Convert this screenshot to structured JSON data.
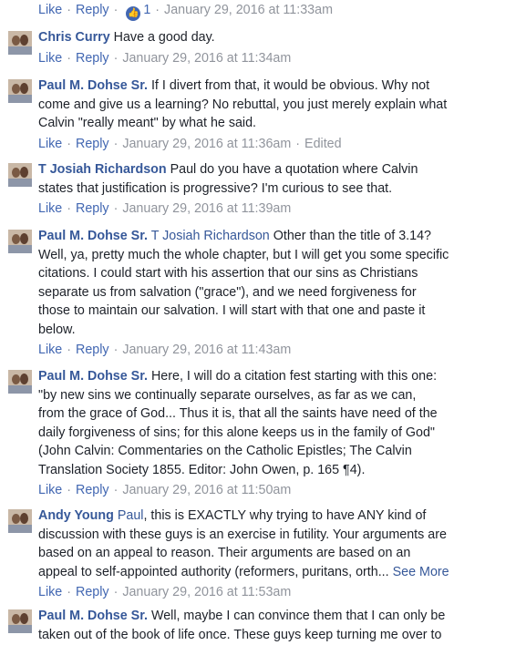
{
  "actions": {
    "like": "Like",
    "reply": "Reply",
    "edited": "Edited",
    "see_more": "See More"
  },
  "top_row": {
    "like_count": "1",
    "timestamp": "January 29, 2016 at 11:33am",
    "like_icon": "thumbs-up-icon",
    "like_icon_color": "#4267b2"
  },
  "comments": [
    {
      "author": "Chris Curry",
      "mention": "",
      "lines": [
        "Have a good day."
      ],
      "timestamp": "January 29, 2016 at 11:34am",
      "edited": false
    },
    {
      "author": "Paul M. Dohse Sr.",
      "mention": "",
      "lines": [
        "If I divert from that, it would be obvious. Why not",
        "come and give us a learning? No rebuttal, you just merely explain what",
        "Calvin \"really meant\" by what he said."
      ],
      "timestamp": "January 29, 2016 at 11:36am",
      "edited": true
    },
    {
      "author": "T Josiah Richardson",
      "mention": "",
      "lines": [
        "Paul do you have a quotation where Calvin",
        "states that justification is progressive? I'm curious to see that."
      ],
      "timestamp": "January 29, 2016 at 11:39am",
      "edited": false
    },
    {
      "author": "Paul M. Dohse Sr.",
      "mention": "T Josiah Richardson",
      "lines": [
        "Other than the title of 3.14?",
        "Well, ya, pretty much the whole chapter, but I will get you some specific",
        "citations. I could start with his assertion that our sins as Christians",
        "separate us from salvation (\"grace\"), and we need forgiveness for",
        "those to maintain our salvation. I will start with that one and paste it",
        "below."
      ],
      "timestamp": "January 29, 2016 at 11:43am",
      "edited": false
    },
    {
      "author": "Paul M. Dohse Sr.",
      "mention": "",
      "lines": [
        "Here, I will do a citation fest starting with this one:",
        "\"by new sins we continually separate ourselves, as far as we can,",
        "from the grace of God... Thus it is, that all the saints have need of the",
        "daily forgiveness of sins; for this alone keeps us in the family of God\"",
        "(John Calvin: Commentaries on the Catholic Epistles; The Calvin",
        "Translation Society 1855. Editor: John Owen, p. 165 ¶4)."
      ],
      "timestamp": "January 29, 2016 at 11:50am",
      "edited": false
    },
    {
      "author": "Andy Young",
      "mention": "Paul",
      "lines": [
        ", this is EXACTLY why trying to have ANY kind of",
        "discussion with these guys is an exercise in futility. Your arguments are",
        "based on an appeal to reason. Their arguments are based on an",
        "appeal to self-appointed authority (reformers, puritans, orth..."
      ],
      "timestamp": "January 29, 2016 at 11:53am",
      "edited": false,
      "see_more": true
    },
    {
      "author": "Paul M. Dohse Sr.",
      "mention": "",
      "lines": [
        "Well, maybe I can convince them that I can only be",
        "taken out of the book of life once. These guys keep turning me over to"
      ],
      "timestamp": "",
      "edited": false
    }
  ]
}
